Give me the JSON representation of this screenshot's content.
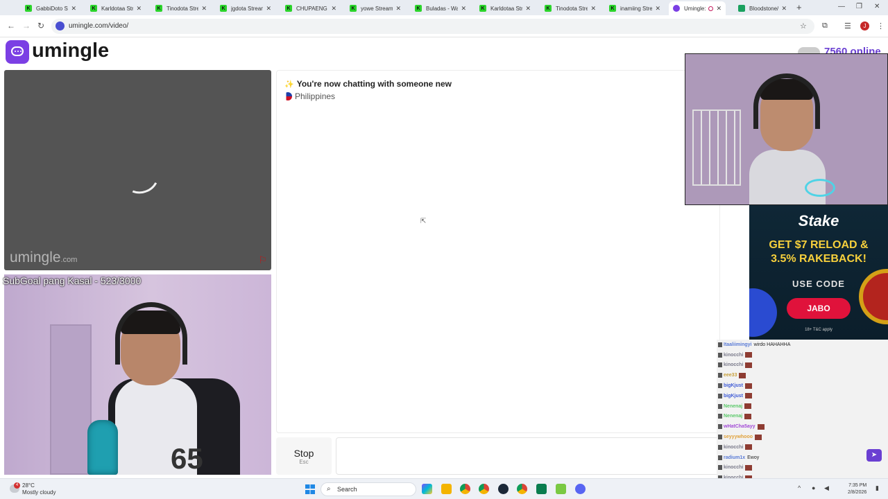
{
  "browser": {
    "tabs": [
      {
        "title": "GabbiDoto Stream",
        "icon": "kick-icon"
      },
      {
        "title": "Karldotaa Stream",
        "icon": "kick-icon"
      },
      {
        "title": "Tinodota Stream",
        "icon": "kick-icon"
      },
      {
        "title": "jgdota Stream",
        "icon": "kick-icon"
      },
      {
        "title": "CHUPAENG Stream",
        "icon": "kick-icon"
      },
      {
        "title": "yowe Stream",
        "icon": "kick-icon"
      },
      {
        "title": "Buladas - Watch",
        "icon": "kick-icon"
      },
      {
        "title": "Karldotaa Stream",
        "icon": "kick-icon"
      },
      {
        "title": "Tinodota Stream",
        "icon": "kick-icon"
      },
      {
        "title": "inamiing Stream",
        "icon": "kick-icon"
      },
      {
        "title": "Umingle: V",
        "icon": "umingle-icon",
        "active": true
      },
      {
        "title": "Bloodstone/M",
        "icon": "sheets-icon"
      }
    ],
    "url": "umingle.com/video/",
    "profile_initial": "J"
  },
  "header": {
    "logo_text": "umingle",
    "online_count": "7560 online"
  },
  "video": {
    "watermark": "umingle",
    "watermark_suffix": ".com",
    "overlay_text": "SubGoal pang Kasal - 523/3000",
    "jersey_number": "65"
  },
  "chat": {
    "status_message": "You're now chatting with someone new",
    "country": "Philippines",
    "stop_label": "Stop",
    "stop_key": "Esc",
    "message_placeholder": ""
  },
  "ad": {
    "brand": "Stake",
    "headline_line1": "GET $7 RELOAD &",
    "headline_line2": "3.5% RAKEBACK!",
    "code_label": "USE CODE",
    "code": "JABO",
    "terms": "18+ T&C apply"
  },
  "stream_chat": [
    {
      "user": "Itaaliimingyi",
      "msg": "wirdo HAHAHHA",
      "color": "#5a7bd6"
    },
    {
      "user": "kinocchi",
      "msg": "",
      "color": "#7a7a8a"
    },
    {
      "user": "kinocchi",
      "msg": "",
      "color": "#7a7a8a"
    },
    {
      "user": "eee33",
      "msg": "",
      "color": "#c8a03a"
    },
    {
      "user": "bigKjust",
      "msg": "",
      "color": "#3d5ad6"
    },
    {
      "user": "bigKjust",
      "msg": "",
      "color": "#3d5ad6"
    },
    {
      "user": "Nenenaj",
      "msg": "",
      "color": "#5bc96a"
    },
    {
      "user": "Nenenaj",
      "msg": "",
      "color": "#5bc96a"
    },
    {
      "user": "wHatCha5ayy",
      "msg": "",
      "color": "#a24ad6"
    },
    {
      "user": "seyyywhooo",
      "msg": "",
      "color": "#e0a13a"
    },
    {
      "user": "kinocchi",
      "msg": "",
      "color": "#7a7a8a"
    },
    {
      "user": "radium1x",
      "msg": "Ewoy",
      "color": "#5a7bd6"
    },
    {
      "user": "kinocchi",
      "msg": "",
      "color": "#7a7a8a"
    },
    {
      "user": "kinocchi",
      "msg": "",
      "color": "#7a7a8a"
    },
    {
      "user": "zeyzx",
      "msg": "",
      "color": "#5bc96a"
    }
  ],
  "taskbar": {
    "temperature": "28°C",
    "weather": "Mostly cloudy",
    "weather_badge": "4",
    "search_label": "Search",
    "time": "7:35 PM",
    "date": "2/8/2026"
  }
}
